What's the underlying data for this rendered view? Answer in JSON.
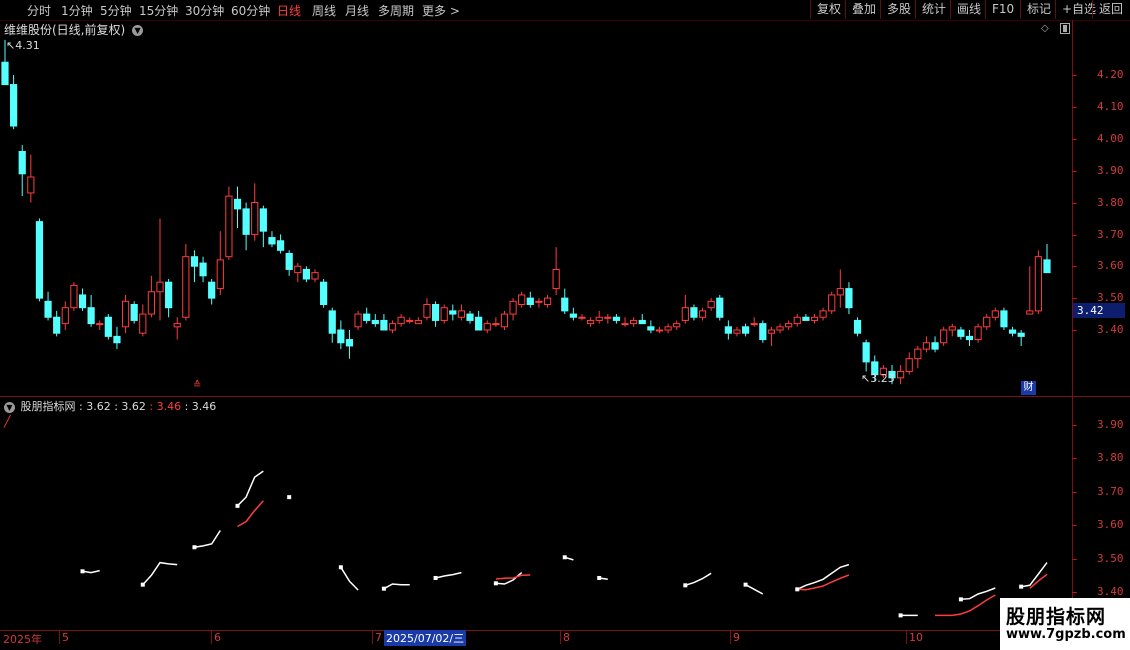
{
  "toolbar": {
    "periods": [
      "分时",
      "1分钟",
      "5分钟",
      "15分钟",
      "30分钟",
      "60分钟",
      "日线",
      "周线",
      "月线",
      "多周期",
      "更多 >"
    ],
    "active_period": "日线",
    "right_buttons": [
      "复权",
      "叠加",
      "多股",
      "统计",
      "画线",
      "F10",
      "标记",
      "+自选",
      "返回"
    ]
  },
  "stock": {
    "title": "维维股份(日线,前复权)",
    "high_label": "4.31",
    "low_label": "3.23",
    "current_price": "3.42",
    "fin_badge": "财",
    "axis_labels": [
      "4.20",
      "4.10",
      "4.00",
      "3.90",
      "3.80",
      "3.70",
      "3.60",
      "3.50",
      "3.40"
    ]
  },
  "indicator": {
    "title": "股朋指标网",
    "values_white": ": 3.62 : 3.62",
    "values_red": ": 3.46",
    "values_tail": ": 3.46",
    "axis_labels": [
      "3.90",
      "3.80",
      "3.70",
      "3.60",
      "3.50",
      "3.40"
    ]
  },
  "timeline": {
    "labels": [
      "2025年",
      "5",
      "6",
      "7",
      "8",
      "9",
      "10"
    ],
    "cursor_date": "2025/07/02/三"
  },
  "watermark": {
    "line1": "股朋指标网",
    "line2": "www.7gpzb.com"
  },
  "colors": {
    "up": "#ff3c3c",
    "down": "#54ffff",
    "axis": "#7a1010",
    "badge": "#0d1e6e"
  },
  "chart_data": {
    "type": "candlestick",
    "columns": [
      "open",
      "high",
      "low",
      "close"
    ],
    "bars": [
      [
        4.24,
        4.31,
        4.17,
        4.17
      ],
      [
        4.17,
        4.2,
        4.03,
        4.04
      ],
      [
        3.96,
        3.98,
        3.82,
        3.89
      ],
      [
        3.83,
        3.95,
        3.8,
        3.88
      ],
      [
        3.74,
        3.75,
        3.49,
        3.5
      ],
      [
        3.49,
        3.52,
        3.43,
        3.44
      ],
      [
        3.44,
        3.46,
        3.38,
        3.39
      ],
      [
        3.42,
        3.49,
        3.4,
        3.47
      ],
      [
        3.47,
        3.55,
        3.46,
        3.54
      ],
      [
        3.51,
        3.53,
        3.46,
        3.47
      ],
      [
        3.47,
        3.51,
        3.41,
        3.42
      ],
      [
        3.42,
        3.43,
        3.4,
        3.42
      ],
      [
        3.44,
        3.45,
        3.37,
        3.38
      ],
      [
        3.38,
        3.41,
        3.34,
        3.36
      ],
      [
        3.41,
        3.51,
        3.39,
        3.49
      ],
      [
        3.48,
        3.49,
        3.42,
        3.43
      ],
      [
        3.39,
        3.48,
        3.38,
        3.45
      ],
      [
        3.45,
        3.57,
        3.44,
        3.52
      ],
      [
        3.52,
        3.75,
        3.43,
        3.55
      ],
      [
        3.55,
        3.56,
        3.44,
        3.47
      ],
      [
        3.41,
        3.44,
        3.37,
        3.42
      ],
      [
        3.44,
        3.67,
        3.43,
        3.63
      ],
      [
        3.63,
        3.65,
        3.55,
        3.6
      ],
      [
        3.61,
        3.63,
        3.55,
        3.57
      ],
      [
        3.55,
        3.56,
        3.48,
        3.5
      ],
      [
        3.53,
        3.71,
        3.51,
        3.62
      ],
      [
        3.63,
        3.85,
        3.62,
        3.82
      ],
      [
        3.81,
        3.85,
        3.72,
        3.78
      ],
      [
        3.78,
        3.8,
        3.65,
        3.7
      ],
      [
        3.7,
        3.86,
        3.68,
        3.8
      ],
      [
        3.78,
        3.79,
        3.66,
        3.71
      ],
      [
        3.69,
        3.71,
        3.66,
        3.67
      ],
      [
        3.68,
        3.7,
        3.64,
        3.65
      ],
      [
        3.64,
        3.65,
        3.57,
        3.59
      ],
      [
        3.58,
        3.61,
        3.55,
        3.6
      ],
      [
        3.59,
        3.6,
        3.55,
        3.56
      ],
      [
        3.56,
        3.59,
        3.55,
        3.58
      ],
      [
        3.55,
        3.56,
        3.47,
        3.48
      ],
      [
        3.46,
        3.47,
        3.36,
        3.39
      ],
      [
        3.4,
        3.43,
        3.34,
        3.36
      ],
      [
        3.37,
        3.4,
        3.31,
        3.35
      ],
      [
        3.41,
        3.46,
        3.4,
        3.45
      ],
      [
        3.45,
        3.47,
        3.42,
        3.43
      ],
      [
        3.43,
        3.45,
        3.41,
        3.42
      ],
      [
        3.43,
        3.45,
        3.4,
        3.4
      ],
      [
        3.4,
        3.43,
        3.39,
        3.42
      ],
      [
        3.42,
        3.45,
        3.41,
        3.44
      ],
      [
        3.43,
        3.44,
        3.42,
        3.43
      ],
      [
        3.42,
        3.44,
        3.42,
        3.43
      ],
      [
        3.44,
        3.5,
        3.43,
        3.48
      ],
      [
        3.48,
        3.49,
        3.41,
        3.43
      ],
      [
        3.43,
        3.48,
        3.42,
        3.47
      ],
      [
        3.46,
        3.48,
        3.43,
        3.45
      ],
      [
        3.44,
        3.48,
        3.43,
        3.46
      ],
      [
        3.45,
        3.46,
        3.42,
        3.43
      ],
      [
        3.44,
        3.46,
        3.42,
        3.4
      ],
      [
        3.4,
        3.43,
        3.39,
        3.42
      ],
      [
        3.42,
        3.44,
        3.41,
        3.42
      ],
      [
        3.41,
        3.46,
        3.4,
        3.45
      ],
      [
        3.45,
        3.5,
        3.43,
        3.49
      ],
      [
        3.48,
        3.52,
        3.47,
        3.51
      ],
      [
        3.5,
        3.52,
        3.47,
        3.48
      ],
      [
        3.49,
        3.5,
        3.47,
        3.49
      ],
      [
        3.48,
        3.51,
        3.47,
        3.5
      ],
      [
        3.53,
        3.66,
        3.51,
        3.59
      ],
      [
        3.5,
        3.53,
        3.45,
        3.46
      ],
      [
        3.45,
        3.47,
        3.43,
        3.44
      ],
      [
        3.44,
        3.45,
        3.43,
        3.44
      ],
      [
        3.42,
        3.44,
        3.41,
        3.43
      ],
      [
        3.43,
        3.46,
        3.42,
        3.44
      ],
      [
        3.44,
        3.45,
        3.42,
        3.44
      ],
      [
        3.44,
        3.45,
        3.42,
        3.43
      ],
      [
        3.42,
        3.44,
        3.41,
        3.42
      ],
      [
        3.42,
        3.44,
        3.41,
        3.43
      ],
      [
        3.43,
        3.45,
        3.42,
        3.42
      ],
      [
        3.41,
        3.43,
        3.39,
        3.4
      ],
      [
        3.4,
        3.41,
        3.39,
        3.4
      ],
      [
        3.4,
        3.42,
        3.39,
        3.41
      ],
      [
        3.41,
        3.43,
        3.4,
        3.42
      ],
      [
        3.43,
        3.51,
        3.42,
        3.47
      ],
      [
        3.47,
        3.48,
        3.43,
        3.44
      ],
      [
        3.44,
        3.47,
        3.43,
        3.46
      ],
      [
        3.47,
        3.5,
        3.46,
        3.49
      ],
      [
        3.5,
        3.51,
        3.43,
        3.44
      ],
      [
        3.41,
        3.43,
        3.37,
        3.39
      ],
      [
        3.39,
        3.41,
        3.38,
        3.4
      ],
      [
        3.41,
        3.42,
        3.38,
        3.39
      ],
      [
        3.42,
        3.44,
        3.41,
        3.42
      ],
      [
        3.42,
        3.43,
        3.36,
        3.37
      ],
      [
        3.39,
        3.41,
        3.35,
        3.4
      ],
      [
        3.4,
        3.42,
        3.39,
        3.41
      ],
      [
        3.41,
        3.43,
        3.4,
        3.42
      ],
      [
        3.42,
        3.45,
        3.41,
        3.44
      ],
      [
        3.44,
        3.45,
        3.43,
        3.43
      ],
      [
        3.43,
        3.45,
        3.42,
        3.44
      ],
      [
        3.44,
        3.47,
        3.43,
        3.46
      ],
      [
        3.46,
        3.52,
        3.45,
        3.51
      ],
      [
        3.51,
        3.59,
        3.47,
        3.53
      ],
      [
        3.53,
        3.55,
        3.45,
        3.47
      ],
      [
        3.43,
        3.44,
        3.38,
        3.39
      ],
      [
        3.36,
        3.37,
        3.27,
        3.3
      ],
      [
        3.3,
        3.32,
        3.24,
        3.26
      ],
      [
        3.26,
        3.29,
        3.25,
        3.28
      ],
      [
        3.27,
        3.29,
        3.23,
        3.25
      ],
      [
        3.25,
        3.29,
        3.23,
        3.27
      ],
      [
        3.27,
        3.33,
        3.26,
        3.31
      ],
      [
        3.31,
        3.35,
        3.28,
        3.34
      ],
      [
        3.34,
        3.38,
        3.33,
        3.36
      ],
      [
        3.36,
        3.38,
        3.33,
        3.34
      ],
      [
        3.36,
        3.41,
        3.35,
        3.4
      ],
      [
        3.4,
        3.42,
        3.38,
        3.41
      ],
      [
        3.4,
        3.41,
        3.37,
        3.38
      ],
      [
        3.38,
        3.4,
        3.35,
        3.37
      ],
      [
        3.37,
        3.42,
        3.36,
        3.41
      ],
      [
        3.41,
        3.45,
        3.4,
        3.44
      ],
      [
        3.44,
        3.47,
        3.43,
        3.46
      ],
      [
        3.46,
        3.47,
        3.4,
        3.41
      ],
      [
        3.4,
        3.41,
        3.38,
        3.39
      ],
      [
        3.39,
        3.4,
        3.35,
        3.38
      ],
      [
        3.45,
        3.6,
        3.45,
        3.46
      ],
      [
        3.46,
        3.65,
        3.45,
        3.63
      ],
      [
        3.62,
        3.67,
        3.58,
        3.58
      ]
    ]
  }
}
